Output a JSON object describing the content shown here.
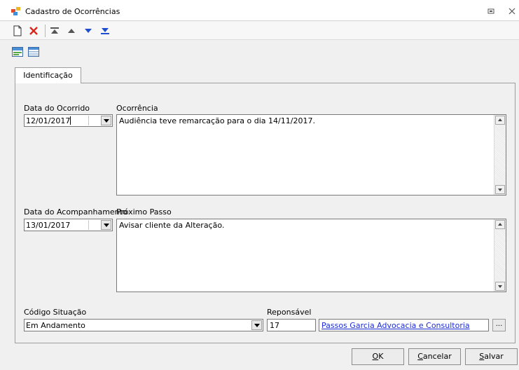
{
  "window": {
    "title": "Cadastro de Ocorrências",
    "buttons": [
      "restore-icon",
      "close-icon"
    ]
  },
  "toolbar": {
    "items": [
      "new-document-icon",
      "delete-icon",
      "first-record-icon",
      "previous-record-icon",
      "next-record-icon",
      "last-record-icon"
    ]
  },
  "view_toolbar": {
    "items": [
      "form-view-icon",
      "grid-view-icon"
    ]
  },
  "tabs": [
    {
      "label": "Identificação",
      "active": true
    }
  ],
  "form": {
    "data_ocorrido": {
      "label": "Data do Ocorrido",
      "value": "12/01/2017"
    },
    "ocorrencia": {
      "label": "Ocorrência",
      "value": "Audiência teve remarcação para o dia 14/11/2017."
    },
    "data_acompanhamento": {
      "label": "Data do Acompanhamento",
      "value": "13/01/2017"
    },
    "proximo_passo": {
      "label": "Próximo Passo",
      "value": "Avisar cliente da Alteração."
    },
    "codigo_situacao": {
      "label": "Código Situação",
      "value": "Em Andamento"
    },
    "responsavel": {
      "label": "Reponsável",
      "code": "17",
      "name": "Passos Garcia Advocacia e Consultoria",
      "browse_label": "..."
    }
  },
  "buttons": {
    "ok": {
      "mnemonic": "O",
      "rest": "K"
    },
    "cancelar": {
      "mnemonic": "C",
      "rest": "ancelar"
    },
    "salvar": {
      "mnemonic": "S",
      "rest": "alvar"
    }
  },
  "colors": {
    "link": "#1a2bd6",
    "delete_icon": "#d9261c",
    "nav_icon": "#1f4fd1"
  }
}
